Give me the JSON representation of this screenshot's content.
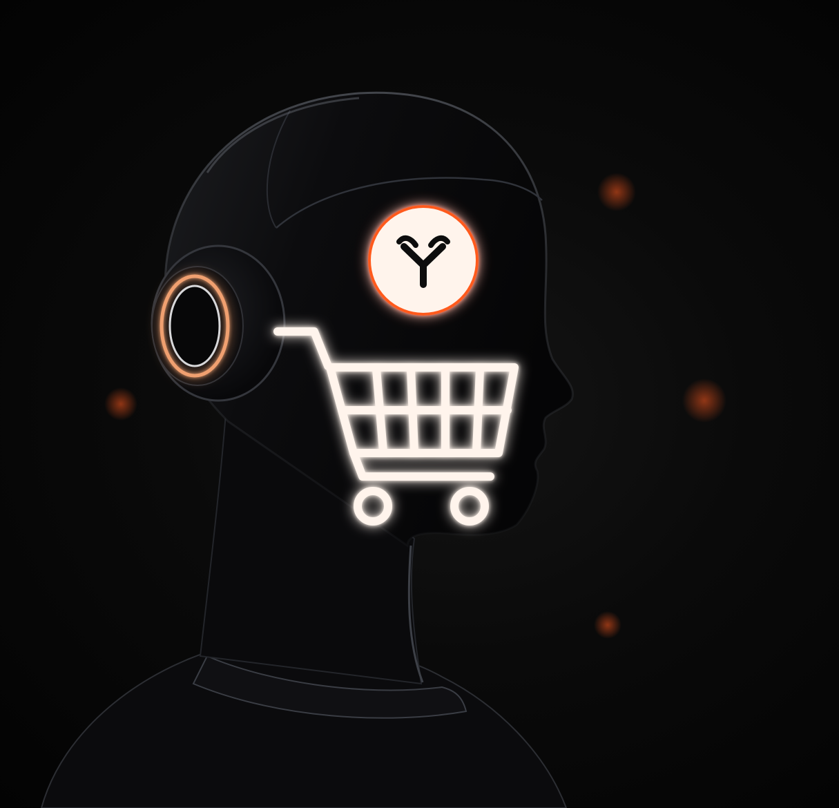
{
  "scene": {
    "subject": "robot-head-silhouette",
    "icons": {
      "logo": "y-logo-icon",
      "cart": "shopping-cart-icon",
      "headphone": "headphone-earpiece-icon",
      "underline": "glow-underline"
    }
  },
  "colors": {
    "background": "#050505",
    "silhouette": "#0e0e10",
    "silhouette_highlight": "#2a2c30",
    "glow": "#ff5a1f",
    "glow_soft": "#ff7a3a",
    "neon_core": "#fff4ec",
    "ear_ring": "#f0a070"
  }
}
